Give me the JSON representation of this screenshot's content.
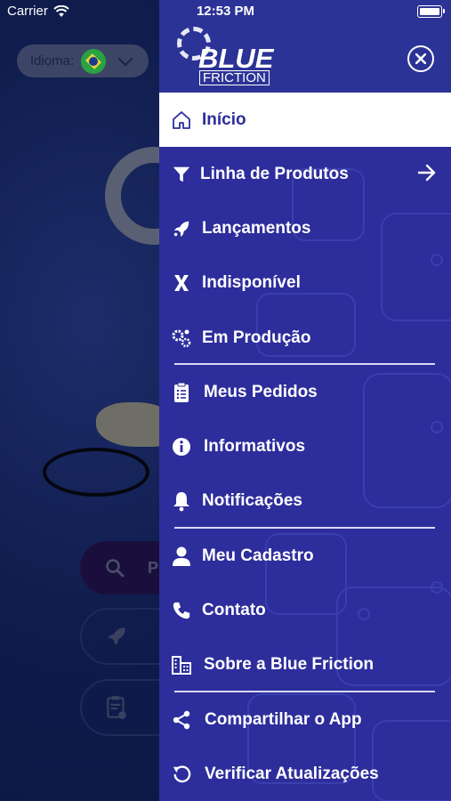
{
  "status_bar": {
    "carrier": "Carrier",
    "time": "12:53 PM"
  },
  "background_app": {
    "language_label": "Idioma:",
    "search_placeholder_visible": "P"
  },
  "drawer": {
    "brand_top": "BLUE",
    "brand_bottom": "FRICTION",
    "menu": [
      {
        "label": "Início",
        "icon": "home-icon",
        "active": true
      },
      {
        "label": "Linha de Produtos",
        "icon": "filter-icon",
        "has_arrow": true
      },
      {
        "label": "Lançamentos",
        "icon": "rocket-icon"
      },
      {
        "label": "Indisponível",
        "icon": "x-icon"
      },
      {
        "label": "Em Produção",
        "icon": "gears-icon"
      },
      {
        "label": "Meus Pedidos",
        "icon": "clipboard-icon"
      },
      {
        "label": "Informativos",
        "icon": "info-icon"
      },
      {
        "label": "Notificações",
        "icon": "bell-icon"
      },
      {
        "label": "Meu Cadastro",
        "icon": "user-icon"
      },
      {
        "label": "Contato",
        "icon": "phone-icon"
      },
      {
        "label": "Sobre a Blue Friction",
        "icon": "building-icon"
      },
      {
        "label": "Compartilhar o App",
        "icon": "share-icon"
      },
      {
        "label": "Verificar Atualizações",
        "icon": "refresh-icon"
      }
    ]
  },
  "colors": {
    "drawer_bg": "#2d2d9c",
    "active_text": "#2d2d9c",
    "active_bg": "#ffffff"
  }
}
